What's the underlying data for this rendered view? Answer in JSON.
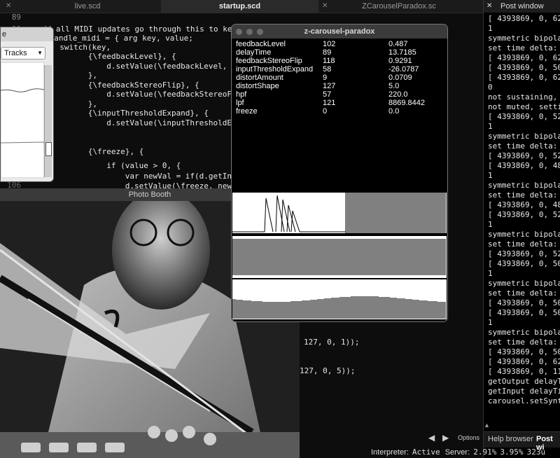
{
  "editor": {
    "tabs": [
      {
        "label": "live.scd",
        "active": false
      },
      {
        "label": "startup.scd",
        "active": true
      },
      {
        "label": "ZCarouselParadox.sc",
        "active": false
      }
    ],
    "line_numbers": [
      "89",
      "90",
      "106"
    ],
    "code_lines": [
      "// all MIDI updates go through this to keep U",
      "~handle_midi = { arg key, value;",
      "  switch(key,",
      "      {\\feedbackLevel}, {",
      "          d.setValue(\\feedbackLevel, value,",
      "      },",
      "      {\\feedbackStereoFlip}, {",
      "          d.setValue(\\feedbackStereoFlip, v",
      "      },",
      "      {\\inputThresholdExpand}, {",
      "          d.setValue(\\inputThresholdExpand,",
      "",
      "      {\\freeze}, {",
      "          if (value > 0, {",
      "              var newVal = if(d.getInput(\\f",
      "              d.setValue(\\freeze, newVal, r"
    ],
    "code_lower": [
      "127, 0, 1));",
      "127, 0, 5));"
    ],
    "bottom_controls": {
      "options_label": "Options"
    }
  },
  "small_window": {
    "title": "e",
    "select_value": "Tracks"
  },
  "photobooth": {
    "title": "Photo Booth"
  },
  "carousel": {
    "title": "z-carousel-paradox",
    "params": [
      {
        "name": "feedbackLevel",
        "midi": "102",
        "value": "0.487"
      },
      {
        "name": "delayTime",
        "midi": "89",
        "value": "13.7185"
      },
      {
        "name": "feedbackStereoFlip",
        "midi": "118",
        "value": "0.9291"
      },
      {
        "name": "inputThresholdExpand",
        "midi": "58",
        "value": "-26.0787"
      },
      {
        "name": "distortAmount",
        "midi": "9",
        "value": "0.0709"
      },
      {
        "name": "distortShape",
        "midi": "127",
        "value": "5.0"
      },
      {
        "name": "hpf",
        "midi": "57",
        "value": "220.0"
      },
      {
        "name": "lpf",
        "midi": "121",
        "value": "8869.8442"
      },
      {
        "name": "freeze",
        "midi": "0",
        "value": "0.0"
      }
    ]
  },
  "post": {
    "title": "Post window",
    "lines": [
      "[ 4393869, 0, 62,",
      "1",
      "symmetric bipolar",
      "set time delta: 10",
      "[ 4393869, 0, 62,",
      "[ 4393869, 0, 50,",
      "[ 4393869, 0, 62,",
      "0",
      "not sustaining, f",
      "not muted, setting",
      "[ 4393869, 0, 52,",
      "1",
      "symmetric bipolar",
      "set time delta: 4",
      "[ 4393869, 0, 52,",
      "[ 4393869, 0, 48,",
      "1",
      "symmetric bipolar",
      "set time delta: 6",
      "[ 4393869, 0, 48,",
      "[ 4393869, 0, 52,",
      "1",
      "symmetric bipolar",
      "set time delta: 8",
      "[ 4393869, 0, 52,",
      "[ 4393869, 0, 50,",
      "1",
      "symmetric bipolar",
      "set time delta: 10",
      "[ 4393869, 0, 50,",
      "[ 4393869, 0, 50,",
      "1",
      "symmetric bipolar",
      "set time delta: 10",
      "[ 4393869, 0, 50,",
      "[ 4393869, 0, 62,",
      "[ 4393869, 0, 11,",
      "getOutput delayTim",
      "getInput delayTime",
      "carousel.setSynth"
    ],
    "bottom_tabs": [
      "Help browser",
      "Post wi"
    ]
  },
  "status": {
    "interpreter_label": "Interpreter:",
    "interpreter_value": "Active",
    "server_label": "Server:",
    "cpu_avg": "2.91%",
    "cpu_peak": "3.95%",
    "ugens": "323u"
  },
  "colors": {
    "editor_bg": "#0d0d0d",
    "window_title": "#3b3b3b",
    "text": "#e8e8e8"
  }
}
